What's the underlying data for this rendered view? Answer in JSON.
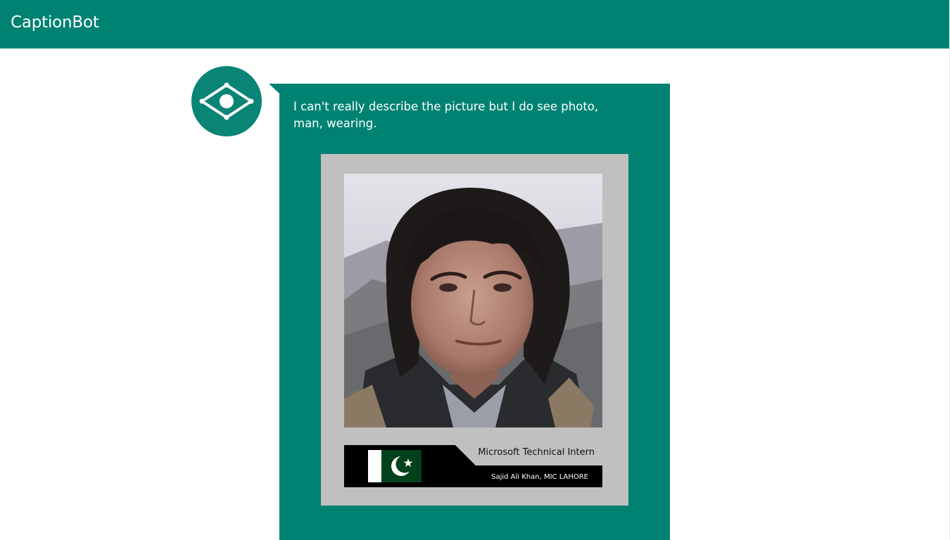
{
  "app": {
    "title": "CaptionBot"
  },
  "bot": {
    "avatar_icon": "eye-icon",
    "message": "I can't really describe the picture but I do see photo, man, wearing."
  },
  "photo": {
    "banner_title": "Microsoft Technical Intern",
    "banner_subtitle": "Sajid Ali Khan, MIC LAHORE",
    "flag_icon": "pakistan-flag-icon"
  },
  "colors": {
    "accent": "#008272",
    "frame": "#c0c0c0"
  }
}
